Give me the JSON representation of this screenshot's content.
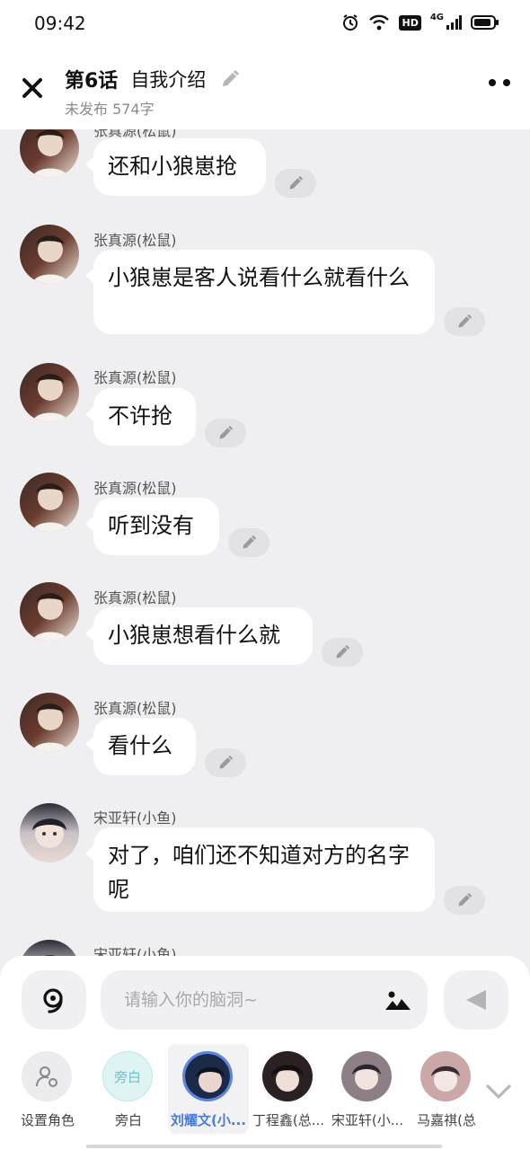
{
  "status": {
    "time": "09:42",
    "hd": "HD",
    "net": "4G"
  },
  "header": {
    "chapter": "第6话",
    "title": "自我介绍",
    "meta": "未发布 574字"
  },
  "chat": {
    "partial_top_name": "张真源(松鼠)",
    "partial_bottom_name": "宋亚轩(小鱼)",
    "messages": [
      {
        "name": "",
        "text": "还和小狼崽抢"
      },
      {
        "name": "张真源(松鼠)",
        "text": "小狼崽是客人说看什么就看什么"
      },
      {
        "name": "张真源(松鼠)",
        "text": "不许抢"
      },
      {
        "name": "张真源(松鼠)",
        "text": "听到没有"
      },
      {
        "name": "张真源(松鼠)",
        "text": "小狼崽想看什么就"
      },
      {
        "name": "张真源(松鼠)",
        "text": "看什么"
      },
      {
        "name": "宋亚轩(小鱼)",
        "text": "对了，咱们还不知道对方的名字呢"
      }
    ]
  },
  "composer": {
    "placeholder": "请输入你的脑洞~"
  },
  "roles": [
    {
      "label": "设置角色",
      "icon": "person-settings-icon"
    },
    {
      "label": "旁白",
      "badge": "旁白"
    },
    {
      "label": "刘耀文(小...",
      "active": true
    },
    {
      "label": "丁程鑫(总..."
    },
    {
      "label": "宋亚轩(小..."
    },
    {
      "label": "马嘉祺(总"
    }
  ],
  "colors": {
    "accent": "#4a7bd6",
    "background": "#efeff1",
    "bubble": "#ffffff"
  }
}
